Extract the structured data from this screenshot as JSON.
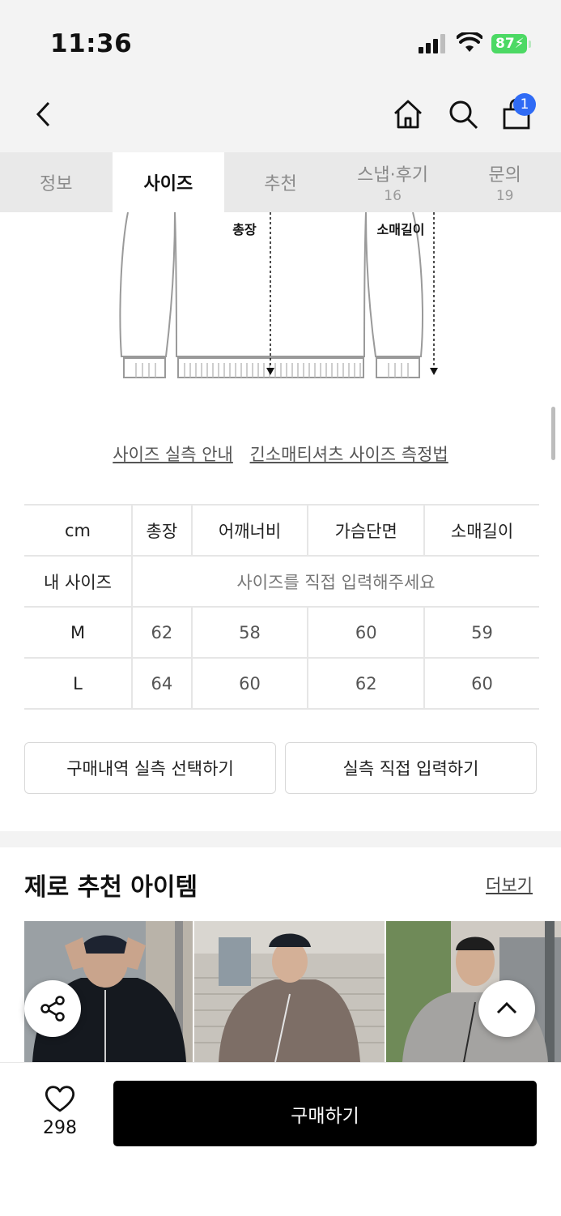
{
  "status_bar": {
    "time": "11:36",
    "battery": "87"
  },
  "header": {
    "cart_count": "1"
  },
  "tabs": [
    {
      "label": "정보",
      "count": ""
    },
    {
      "label": "사이즈",
      "count": ""
    },
    {
      "label": "추천",
      "count": ""
    },
    {
      "label": "스냅·후기",
      "count": "16"
    },
    {
      "label": "문의",
      "count": "19"
    }
  ],
  "diagram": {
    "length_label": "총장",
    "sleeve_label": "소매길이"
  },
  "links": {
    "size_guide": "사이즈 실측 안내",
    "measure_method": "긴소매티셔츠 사이즈 측정법"
  },
  "size_table": {
    "headers": [
      "cm",
      "총장",
      "어깨너비",
      "가슴단면",
      "소매길이"
    ],
    "my_size_label": "내 사이즈",
    "my_size_hint": "사이즈를 직접 입력해주세요",
    "rows": [
      {
        "size": "M",
        "values": [
          "62",
          "58",
          "60",
          "59"
        ]
      },
      {
        "size": "L",
        "values": [
          "64",
          "60",
          "62",
          "60"
        ]
      }
    ]
  },
  "buttons": {
    "history": "구매내역 실측 선택하기",
    "manual": "실측 직접 입력하기"
  },
  "recommend": {
    "title": "제로 추천 아이템",
    "more": "더보기"
  },
  "bottom": {
    "likes": "298",
    "buy": "구매하기"
  },
  "colors": {
    "accent_blue": "#2f6bf5",
    "battery_green": "#4cd964",
    "buy_bg": "#000000"
  },
  "icons": [
    "back-icon",
    "home-icon",
    "search-icon",
    "cart-icon",
    "share-icon",
    "scroll-top-icon",
    "heart-icon"
  ]
}
